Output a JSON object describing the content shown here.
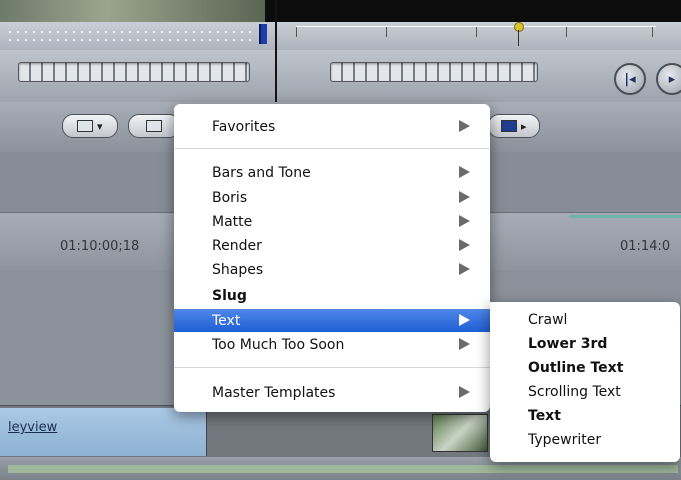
{
  "timeline": {
    "timecode_left": "01:10:00;18",
    "timecode_right": "01:14:0",
    "clip_name": "leyview"
  },
  "context_menu": {
    "items": [
      {
        "label": "Favorites",
        "submenu": true,
        "bold": false
      },
      {
        "label": "Bars and Tone",
        "submenu": true,
        "bold": false
      },
      {
        "label": "Boris",
        "submenu": true,
        "bold": false
      },
      {
        "label": "Matte",
        "submenu": true,
        "bold": false
      },
      {
        "label": "Render",
        "submenu": true,
        "bold": false
      },
      {
        "label": "Shapes",
        "submenu": true,
        "bold": false
      },
      {
        "label": "Slug",
        "submenu": false,
        "bold": true
      },
      {
        "label": "Text",
        "submenu": true,
        "bold": false,
        "highlighted": true
      },
      {
        "label": "Too Much Too Soon",
        "submenu": true,
        "bold": false
      },
      {
        "label": "Master Templates",
        "submenu": true,
        "bold": false
      }
    ]
  },
  "text_submenu": {
    "items": [
      {
        "label": "Crawl",
        "bold": false
      },
      {
        "label": "Lower 3rd",
        "bold": true
      },
      {
        "label": "Outline Text",
        "bold": true
      },
      {
        "label": "Scrolling Text",
        "bold": false
      },
      {
        "label": "Text",
        "bold": true
      },
      {
        "label": "Typewriter",
        "bold": false
      }
    ]
  },
  "colors": {
    "highlight": "#2a68dc",
    "clip": "#9dbfe0"
  }
}
